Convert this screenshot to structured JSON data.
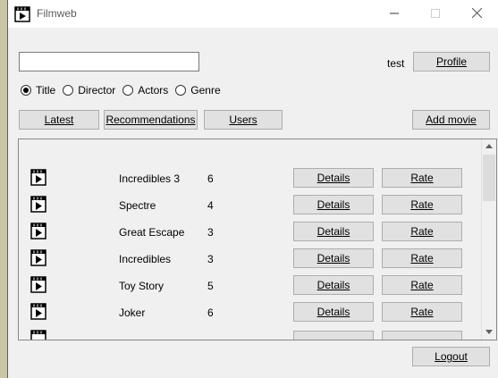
{
  "window": {
    "title": "Filmweb"
  },
  "header": {
    "username": "test",
    "profile_label": "Profile",
    "search_value": ""
  },
  "search_options": [
    {
      "label": "Title",
      "selected": true
    },
    {
      "label": "Director",
      "selected": false
    },
    {
      "label": "Actors",
      "selected": false
    },
    {
      "label": "Genre",
      "selected": false
    }
  ],
  "toolbar": {
    "latest_label": "Latest",
    "recommendations_label": "Recommendations",
    "users_label": "Users",
    "add_movie_label": "Add movie"
  },
  "movies": [
    {
      "title": "Incredibles 3",
      "rating": "6"
    },
    {
      "title": "Spectre",
      "rating": "4"
    },
    {
      "title": "Great Escape",
      "rating": "3"
    },
    {
      "title": "Incredibles",
      "rating": "3"
    },
    {
      "title": "Toy Story",
      "rating": "5"
    },
    {
      "title": "Joker",
      "rating": "6"
    }
  ],
  "row_actions": {
    "details_label": "Details",
    "rate_label": "Rate"
  },
  "footer": {
    "logout_label": "Logout"
  },
  "icons": {
    "app": "clapperboard-icon",
    "movie": "clapperboard-icon"
  }
}
